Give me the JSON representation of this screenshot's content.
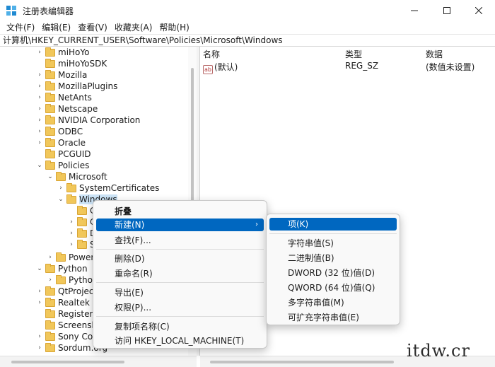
{
  "window": {
    "title": "注册表编辑器"
  },
  "menubar": [
    "文件(F)",
    "编辑(E)",
    "查看(V)",
    "收藏夹(A)",
    "帮助(H)"
  ],
  "address": "计算机\\HKEY_CURRENT_USER\\Software\\Policies\\Microsoft\\Windows",
  "tree": {
    "nodes": [
      {
        "label": "miHoYo"
      },
      {
        "label": "miHoYoSDK"
      },
      {
        "label": "Mozilla"
      },
      {
        "label": "MozillaPlugins"
      },
      {
        "label": "NetAnts"
      },
      {
        "label": "Netscape"
      },
      {
        "label": "NVIDIA Corporation"
      },
      {
        "label": "ODBC"
      },
      {
        "label": "Oracle"
      },
      {
        "label": "PCGUID"
      },
      {
        "label": "Policies"
      },
      {
        "label": "Microsoft"
      },
      {
        "label": "SystemCertificates"
      },
      {
        "label": "Windows"
      },
      {
        "label": "C"
      },
      {
        "label": "C"
      },
      {
        "label": "D"
      },
      {
        "label": "S"
      },
      {
        "label": "Power"
      },
      {
        "label": "Python"
      },
      {
        "label": "Pytho"
      },
      {
        "label": "QtProjec"
      },
      {
        "label": "Realtek"
      },
      {
        "label": "Registere"
      },
      {
        "label": "Screensh"
      },
      {
        "label": "Sony Cor"
      },
      {
        "label": "Sordum.org"
      }
    ]
  },
  "list": {
    "headers": {
      "name": "名称",
      "type": "类型",
      "data": "数据"
    },
    "rows": [
      {
        "name": "(默认)",
        "type": "REG_SZ",
        "data": "(数值未设置)"
      }
    ],
    "value_icon": "ab"
  },
  "context_menu": {
    "items": [
      "折叠",
      "新建(N)",
      "查找(F)...",
      "删除(D)",
      "重命名(R)",
      "导出(E)",
      "权限(P)...",
      "复制项名称(C)",
      "访问 HKEY_LOCAL_MACHINE(T)"
    ]
  },
  "submenu": {
    "items": [
      "项(K)",
      "字符串值(S)",
      "二进制值(B)",
      "DWORD (32 位)值(D)",
      "QWORD (64 位)值(Q)",
      "多字符串值(M)",
      "可扩充字符串值(E)"
    ]
  },
  "watermark": "itdw.cr",
  "colors": {
    "highlight": "#0067c0",
    "folder": "#f1c75a",
    "selection": "#cce4f7"
  }
}
